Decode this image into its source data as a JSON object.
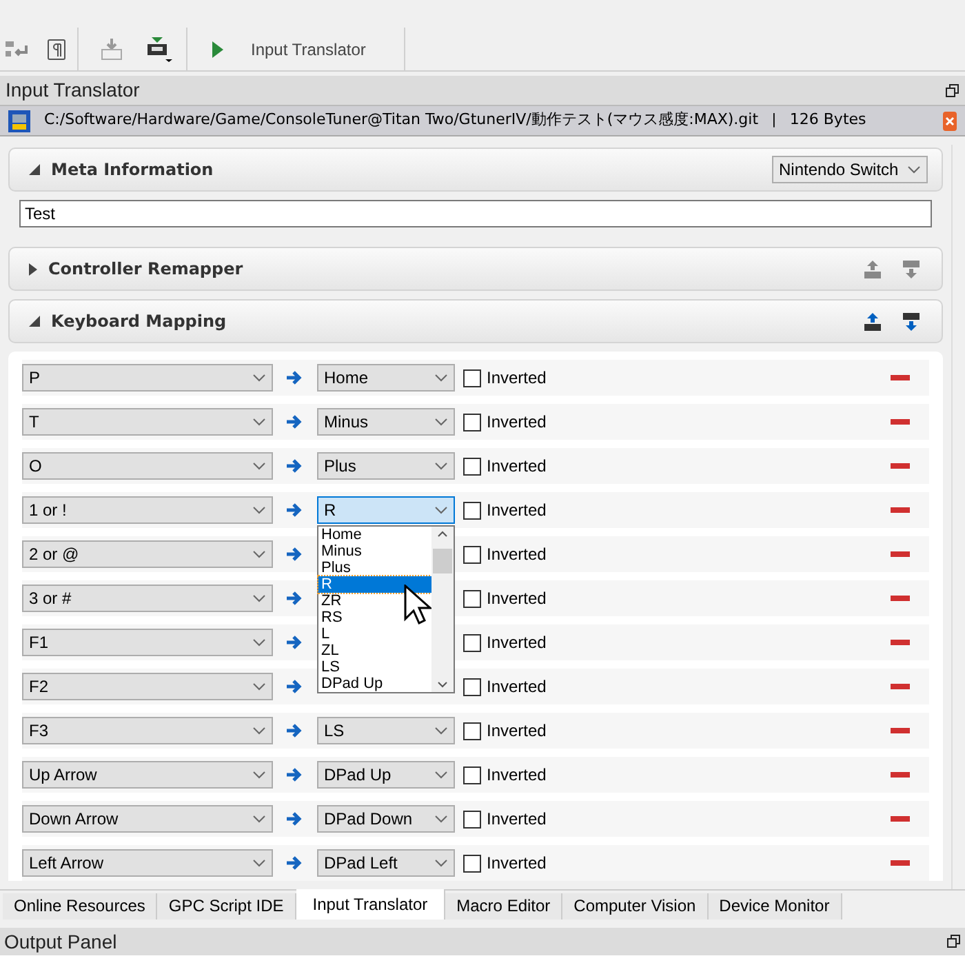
{
  "toolbar": {
    "run_label": "Input Translator"
  },
  "panel": {
    "title": "Input Translator"
  },
  "file": {
    "path": "C:/Software/Hardware/Game/ConsoleTuner@Titan Two/GtunerIV/動作テスト(マウス感度:MAX).git",
    "separator": "|",
    "size": "126 Bytes"
  },
  "meta": {
    "title": "Meta Information",
    "expanded": true,
    "console": "Nintendo Switch",
    "name": "Test"
  },
  "remapper": {
    "title": "Controller Remapper",
    "expanded": false
  },
  "keyboard": {
    "title": "Keyboard Mapping",
    "expanded": true,
    "rows": [
      {
        "key": "P",
        "target": "Home",
        "inverted": false,
        "label": "Inverted"
      },
      {
        "key": "T",
        "target": "Minus",
        "inverted": false,
        "label": "Inverted"
      },
      {
        "key": "O",
        "target": "Plus",
        "inverted": false,
        "label": "Inverted"
      },
      {
        "key": "1 or !",
        "target": "R",
        "inverted": false,
        "label": "Inverted",
        "open": true
      },
      {
        "key": "2 or @",
        "inverted": false,
        "label": "Inverted"
      },
      {
        "key": "3 or #",
        "inverted": false,
        "label": "Inverted"
      },
      {
        "key": "F1",
        "inverted": false,
        "label": "Inverted"
      },
      {
        "key": "F2",
        "inverted": false,
        "label": "Inverted"
      },
      {
        "key": "F3",
        "target": "LS",
        "inverted": false,
        "label": "Inverted"
      },
      {
        "key": "Up Arrow",
        "target": "DPad Up",
        "inverted": false,
        "label": "Inverted"
      },
      {
        "key": "Down Arrow",
        "target": "DPad Down",
        "inverted": false,
        "label": "Inverted"
      },
      {
        "key": "Left Arrow",
        "target": "DPad Left",
        "inverted": false,
        "label": "Inverted"
      }
    ],
    "dropdown": [
      {
        "label": "Home",
        "selected": false
      },
      {
        "label": "Minus",
        "selected": false
      },
      {
        "label": "Plus",
        "selected": false
      },
      {
        "label": "R",
        "selected": true
      },
      {
        "label": "ZR",
        "selected": false
      },
      {
        "label": "RS",
        "selected": false
      },
      {
        "label": "L",
        "selected": false
      },
      {
        "label": "ZL",
        "selected": false
      },
      {
        "label": "LS",
        "selected": false
      },
      {
        "label": "DPad Up",
        "selected": false
      }
    ]
  },
  "tabs": [
    {
      "label": "Online Resources",
      "selected": false
    },
    {
      "label": "GPC Script IDE",
      "selected": false
    },
    {
      "label": "Input Translator",
      "selected": true
    },
    {
      "label": "Macro Editor",
      "selected": false
    },
    {
      "label": "Computer Vision",
      "selected": false
    },
    {
      "label": "Device Monitor",
      "selected": false
    }
  ],
  "output": {
    "title": "Output Panel"
  }
}
